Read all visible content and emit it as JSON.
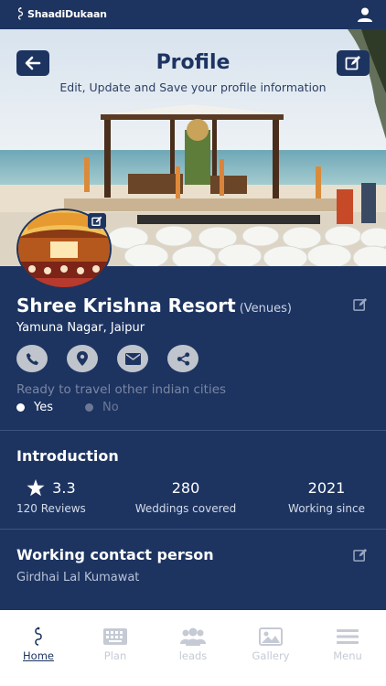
{
  "app": {
    "brand": "ShaadiDukaan"
  },
  "header": {
    "title": "Profile",
    "subtitle": "Edit, Update and Save your profile information"
  },
  "profile": {
    "name": "Shree Krishna Resort",
    "category": "(Venues)",
    "location": "Yamuna Nagar, Jaipur",
    "travel_question": "Ready to travel other indian cities",
    "travel_yes": "Yes",
    "travel_no": "No",
    "travel_selected": "Yes"
  },
  "introduction": {
    "title": "Introduction",
    "rating": "3.3",
    "reviews_label": "120 Reviews",
    "weddings": "280",
    "weddings_label": "Weddings covered",
    "since": "2021",
    "since_label": "Working since"
  },
  "contact": {
    "title": "Working contact person",
    "name": "Girdhai Lal Kumawat"
  },
  "tabs": [
    {
      "label": "Home",
      "icon": "home-logo-icon",
      "active": true
    },
    {
      "label": "Plan",
      "icon": "keyboard-icon"
    },
    {
      "label": "leads",
      "icon": "group-icon"
    },
    {
      "label": "Gallery",
      "icon": "image-icon"
    },
    {
      "label": "Menu",
      "icon": "hamburger-icon"
    }
  ],
  "colors": {
    "primary": "#1d3461",
    "tab_inactive": "#c5cad4",
    "circle_button": "#c0c4cc"
  }
}
